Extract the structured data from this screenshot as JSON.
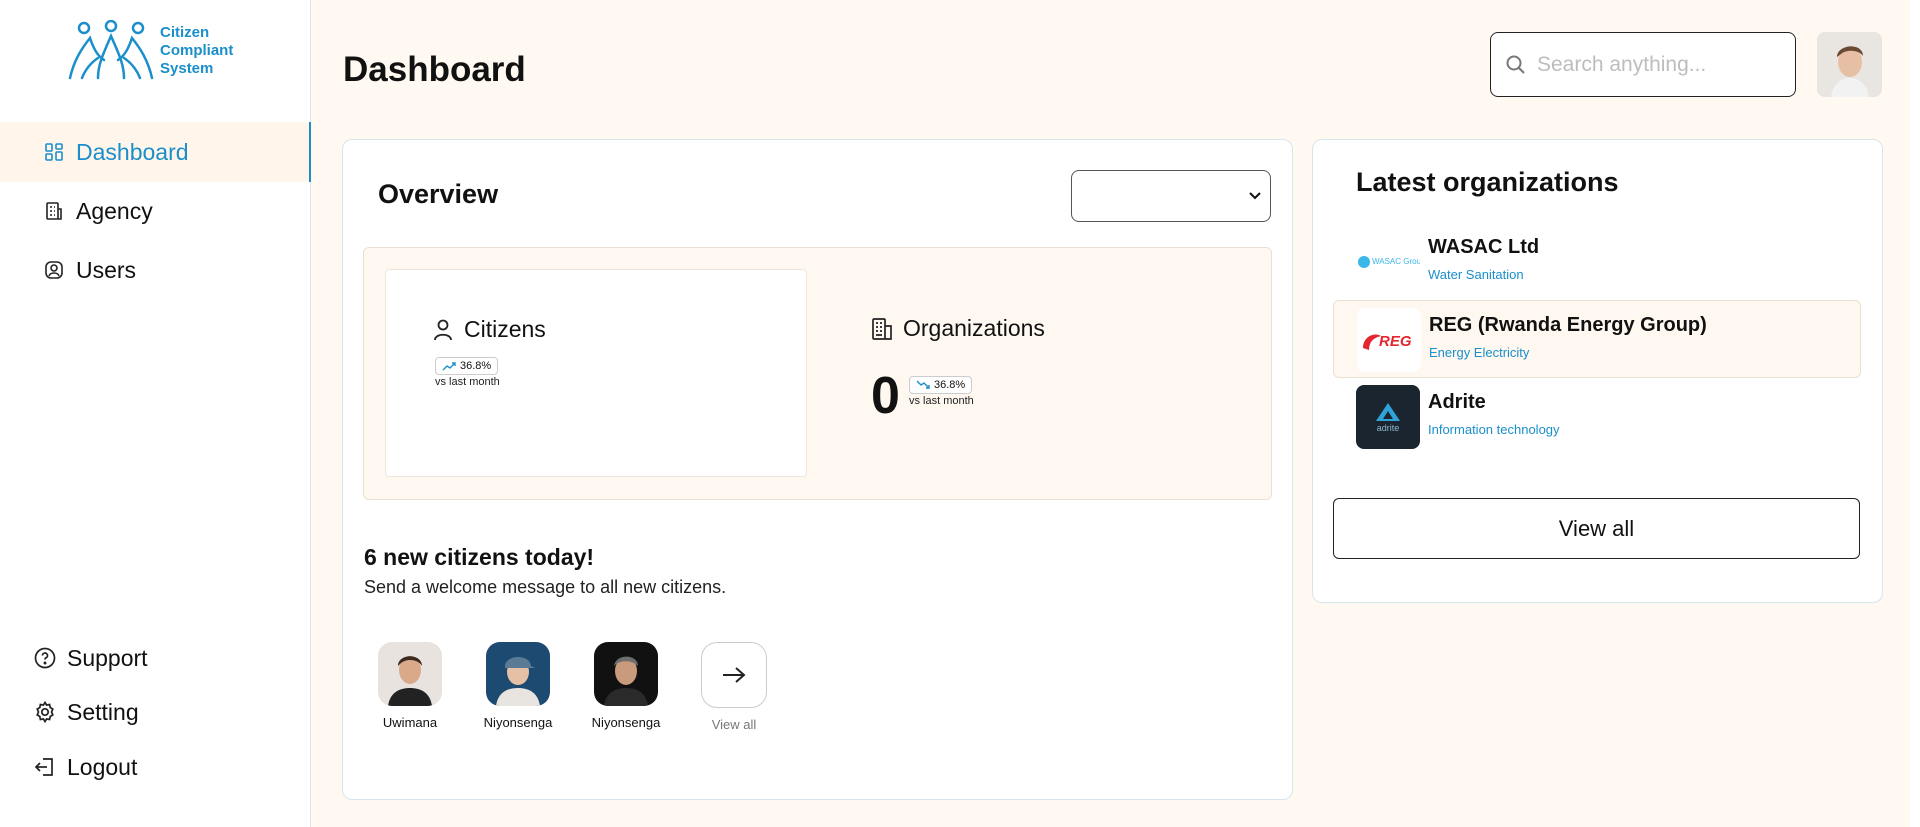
{
  "brand": {
    "line1": "Citizen",
    "line2": "Compliant",
    "line3": "System",
    "color": "#1a8fcb"
  },
  "sidebar": {
    "items": [
      {
        "label": "Dashboard",
        "icon": "dashboard-icon",
        "active": true
      },
      {
        "label": "Agency",
        "icon": "building-icon"
      },
      {
        "label": "Users",
        "icon": "user-circle-icon"
      }
    ],
    "bottom": [
      {
        "label": "Support",
        "icon": "help-icon"
      },
      {
        "label": "Setting",
        "icon": "gear-icon"
      },
      {
        "label": "Logout",
        "icon": "logout-icon"
      }
    ]
  },
  "header": {
    "title": "Dashboard",
    "search_placeholder": "Search anything..."
  },
  "overview": {
    "title": "Overview",
    "select_value": "",
    "citizens": {
      "label": "Citizens",
      "trend": "36.8%",
      "trend_dir": "up",
      "vs": "vs last month"
    },
    "organizations": {
      "label": "Organizations",
      "count": "0",
      "trend": "36.8%",
      "trend_dir": "down",
      "vs": "vs last month"
    },
    "new_title": "6 new citizens today!",
    "new_sub": "Send a welcome message to all new citizens.",
    "people": [
      {
        "name": "Uwimana"
      },
      {
        "name": "Niyonsenga"
      },
      {
        "name": "Niyonsenga"
      }
    ],
    "view_all": "View all"
  },
  "latest_orgs": {
    "title": "Latest organizations",
    "items": [
      {
        "name": "WASAC Ltd",
        "category": "Water Sanitation",
        "logo_text": "WASAC Group"
      },
      {
        "name": "REG (Rwanda Energy Group)",
        "category": "Energy Electricity",
        "logo_text": "REG"
      },
      {
        "name": "Adrite",
        "category": "Information technology",
        "logo_text": "adrite"
      }
    ],
    "view_all": "View all"
  }
}
